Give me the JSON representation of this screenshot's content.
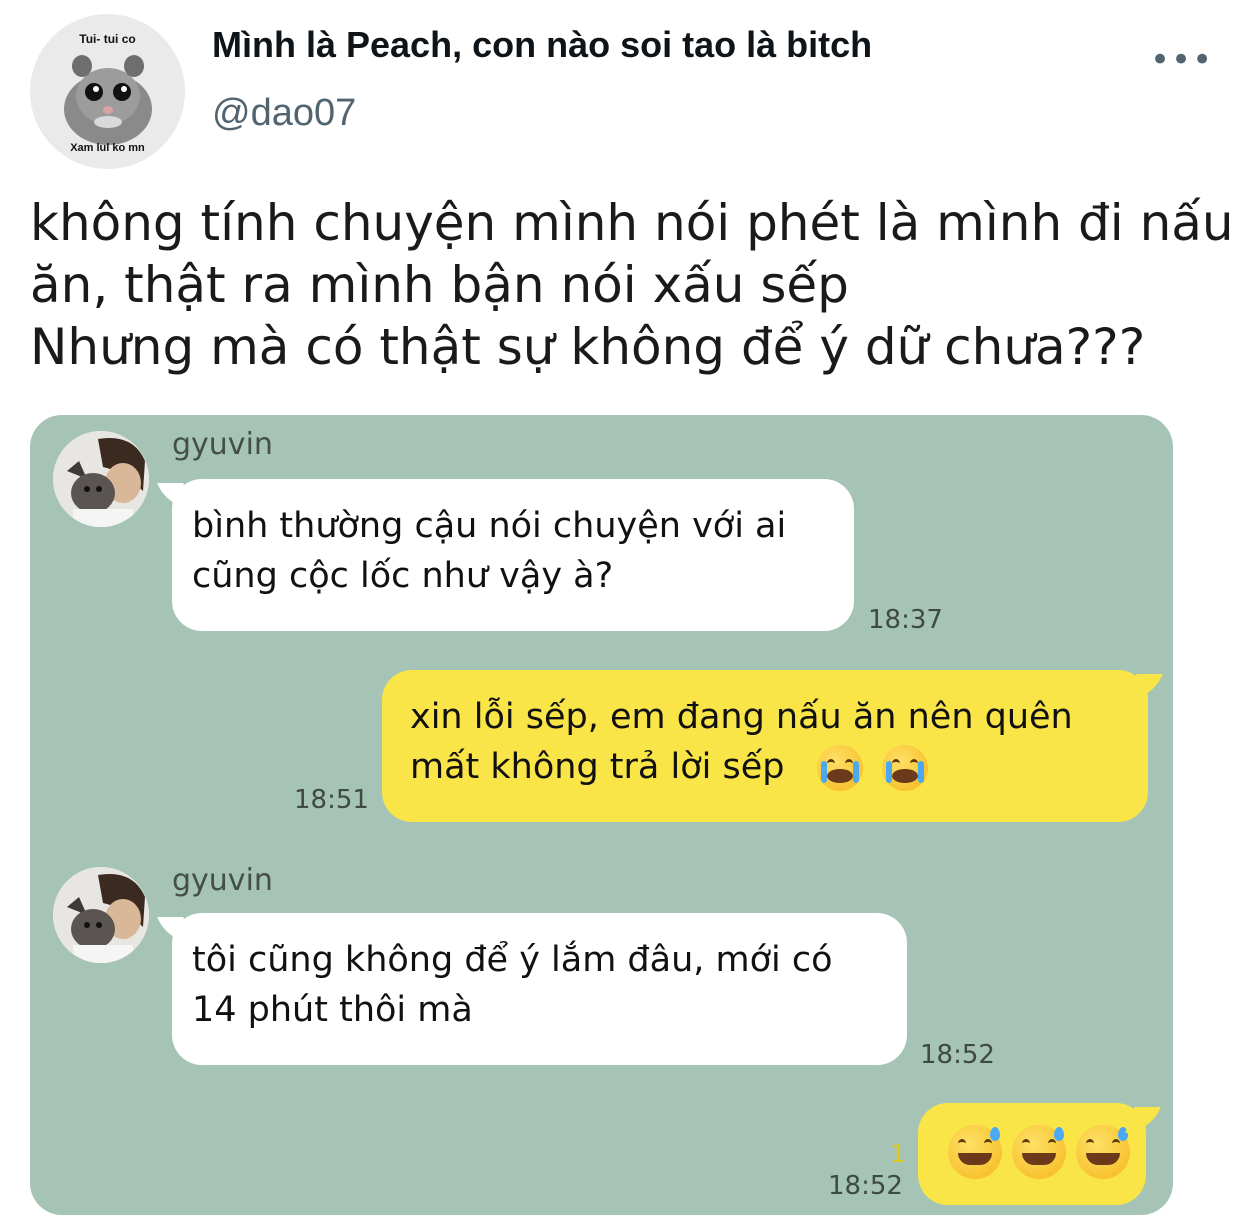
{
  "profile": {
    "avatar_caption_top": "Tui- tui co",
    "avatar_caption_bottom": "Xam lul ko mn",
    "display_name": "Mình là Peach, con nào soi tao là bitch",
    "handle": "@dao07",
    "more_icon": "•••"
  },
  "tweet": {
    "lines": [
      "không tính chuyện mình nói phét là mình đi nấu",
      "ăn, thật ra mình bận nói xấu sếp",
      "Nhưng mà có thật sự không để ý dữ chưa???"
    ]
  },
  "chat": {
    "messages": [
      {
        "sender": "gyuvin",
        "lines": [
          "bình thường cậu nói chuyện với ai",
          "cũng cộc lốc như vậy à?"
        ],
        "time": "18:37"
      },
      {
        "lines": [
          "xin lỗi sếp, em đang nấu ăn nên quên",
          "mất không trả lời sếp"
        ],
        "emojis": [
          "loudly-crying-face",
          "loudly-crying-face"
        ],
        "time": "18:51"
      },
      {
        "sender": "gyuvin",
        "lines": [
          "tôi cũng không để ý lắm đâu, mới có",
          "14 phút thôi mà"
        ],
        "time": "18:52"
      },
      {
        "emojis": [
          "grinning-sweat-face",
          "grinning-sweat-face",
          "grinning-sweat-face"
        ],
        "read_count": "1",
        "time": "18:52"
      }
    ]
  },
  "colors": {
    "chat_background": "#a6c4b6",
    "outgoing_bubble": "#f9e547",
    "incoming_bubble": "#ffffff"
  }
}
